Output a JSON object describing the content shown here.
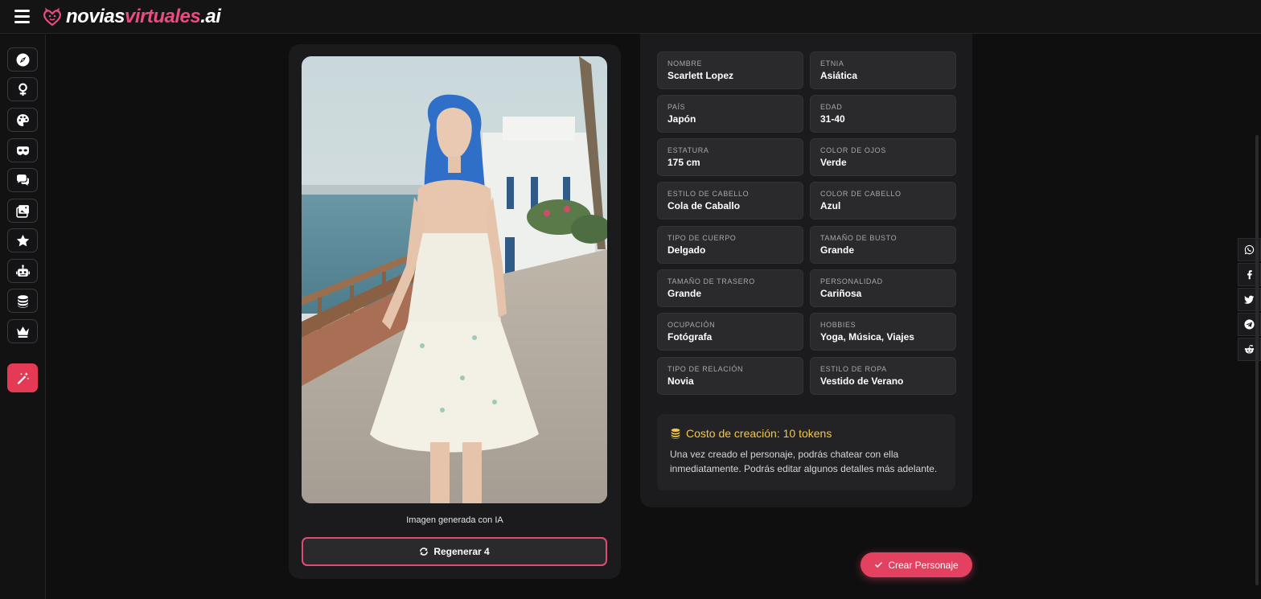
{
  "header": {
    "logo_part1": "novias",
    "logo_part2": "virtuales",
    "logo_part3": ".ai"
  },
  "sidebar": {
    "items": [
      {
        "icon": "compass-icon"
      },
      {
        "icon": "female-icon"
      },
      {
        "icon": "palette-icon"
      },
      {
        "icon": "mask-icon"
      },
      {
        "icon": "chat-icon"
      },
      {
        "icon": "images-icon"
      },
      {
        "icon": "star-icon"
      },
      {
        "icon": "robot-icon"
      },
      {
        "icon": "coins-icon"
      },
      {
        "icon": "crown-icon"
      },
      {
        "icon": "magic-wand-icon",
        "active": true
      }
    ]
  },
  "image_panel": {
    "caption": "Imagen generada con IA",
    "regenerate_label": "Regenerar 4"
  },
  "details": {
    "fields": [
      {
        "label": "NOMBRE",
        "value": "Scarlett Lopez"
      },
      {
        "label": "ETNIA",
        "value": "Asiática"
      },
      {
        "label": "PAÍS",
        "value": "Japón"
      },
      {
        "label": "EDAD",
        "value": "31-40"
      },
      {
        "label": "ESTATURA",
        "value": "175 cm"
      },
      {
        "label": "COLOR DE OJOS",
        "value": "Verde"
      },
      {
        "label": "ESTILO DE CABELLO",
        "value": "Cola de Caballo"
      },
      {
        "label": "COLOR DE CABELLO",
        "value": "Azul"
      },
      {
        "label": "TIPO DE CUERPO",
        "value": "Delgado"
      },
      {
        "label": "TAMAÑO DE BUSTO",
        "value": "Grande"
      },
      {
        "label": "TAMAÑO DE TRASERO",
        "value": "Grande"
      },
      {
        "label": "PERSONALIDAD",
        "value": "Cariñosa"
      },
      {
        "label": "OCUPACIÓN",
        "value": "Fotógrafa"
      },
      {
        "label": "HOBBIES",
        "value": "Yoga, Música, Viajes"
      },
      {
        "label": "TIPO DE RELACIÓN",
        "value": "Novia"
      },
      {
        "label": "ESTILO DE ROPA",
        "value": "Vestido de Verano"
      }
    ],
    "cost_title": "Costo de creación: 10 tokens",
    "cost_desc_line1": "Una vez creado el personaje, podrás chatear con ella",
    "cost_desc_line2": "inmediatamente. Podrás editar algunos detalles más adelante."
  },
  "create_button": "Crear Personaje",
  "share": [
    "whatsapp-icon",
    "facebook-icon",
    "twitter-icon",
    "telegram-icon",
    "reddit-icon"
  ],
  "colors": {
    "accent": "#e4405f",
    "brand_pink": "#ec4b7f",
    "gold": "#f6c744",
    "background": "#0f0f10",
    "card": "#1b1b1d"
  }
}
